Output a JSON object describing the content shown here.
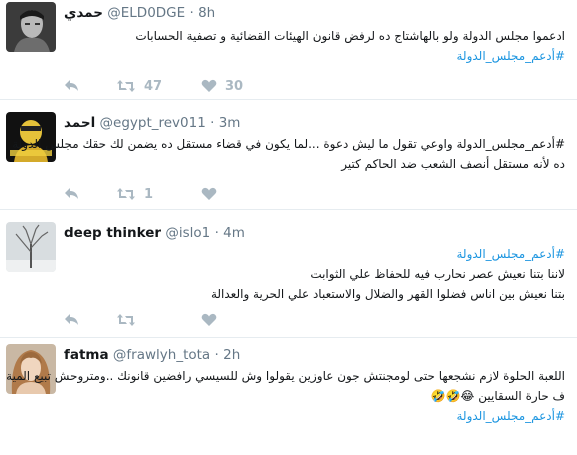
{
  "tweets": [
    {
      "name": "حمدي",
      "handle": "@ELD0DGE",
      "time": "8h",
      "lines": [
        "ادعموا مجلس الدولة ولو بالهاشتاج ده لرفض قانون الهيئات القضائية و تصفية الحسابات"
      ],
      "hashtag": "#أدعم_مجلس_الدولة",
      "retweets": "47",
      "likes": "30",
      "avatar": "man-portrait"
    },
    {
      "name": "احمد",
      "handle": "@egypt_rev011",
      "time": "3m",
      "lines": [
        "#أدعم_مجلس_الدولة  واوعي تقول ما ليش دعوة ...لما يكون في قضاء مستقل ده يضمن لك حقك  مجلس الدولة",
        "ده لأنه مستقل أنصف الشعب ضد الحاكم كتير"
      ],
      "retweets": "1",
      "likes": "",
      "avatar": "yellow-graphic"
    },
    {
      "name": "deep thinker",
      "handle": "@islo1",
      "time": "4m",
      "hashtag": "#أدعم_مجلس_الدولة",
      "lines": [
        "لاننا بتنا نعيش عصر نحارب فيه للحفاظ علي الثوابت",
        "بتنا نعيش بين اناس فضلوا القهر والضلال والاستعباد علي الحرية والعدالة"
      ],
      "retweets": "",
      "likes": "",
      "avatar": "bare-tree"
    },
    {
      "name": "fatma",
      "handle": "@frawlyh_tota",
      "time": "2h",
      "lines": [
        "اللعبة الحلوة لازم نشجعها حتى لومجنتش جون عاوزين يقولوا وش للسيسي رافضين قانونك ..ومتروحش تبيع المية",
        "ف حارة السقايين"
      ],
      "emoji": "😂🤣🤣",
      "hashtag": "#أدعم_مجلس_الدولة",
      "avatar": "woman-portrait"
    }
  ],
  "colors": {
    "hashtag": "#1b95e0",
    "icon": "#aab8c2",
    "muted": "#657786",
    "divider": "#e6ecf0"
  }
}
